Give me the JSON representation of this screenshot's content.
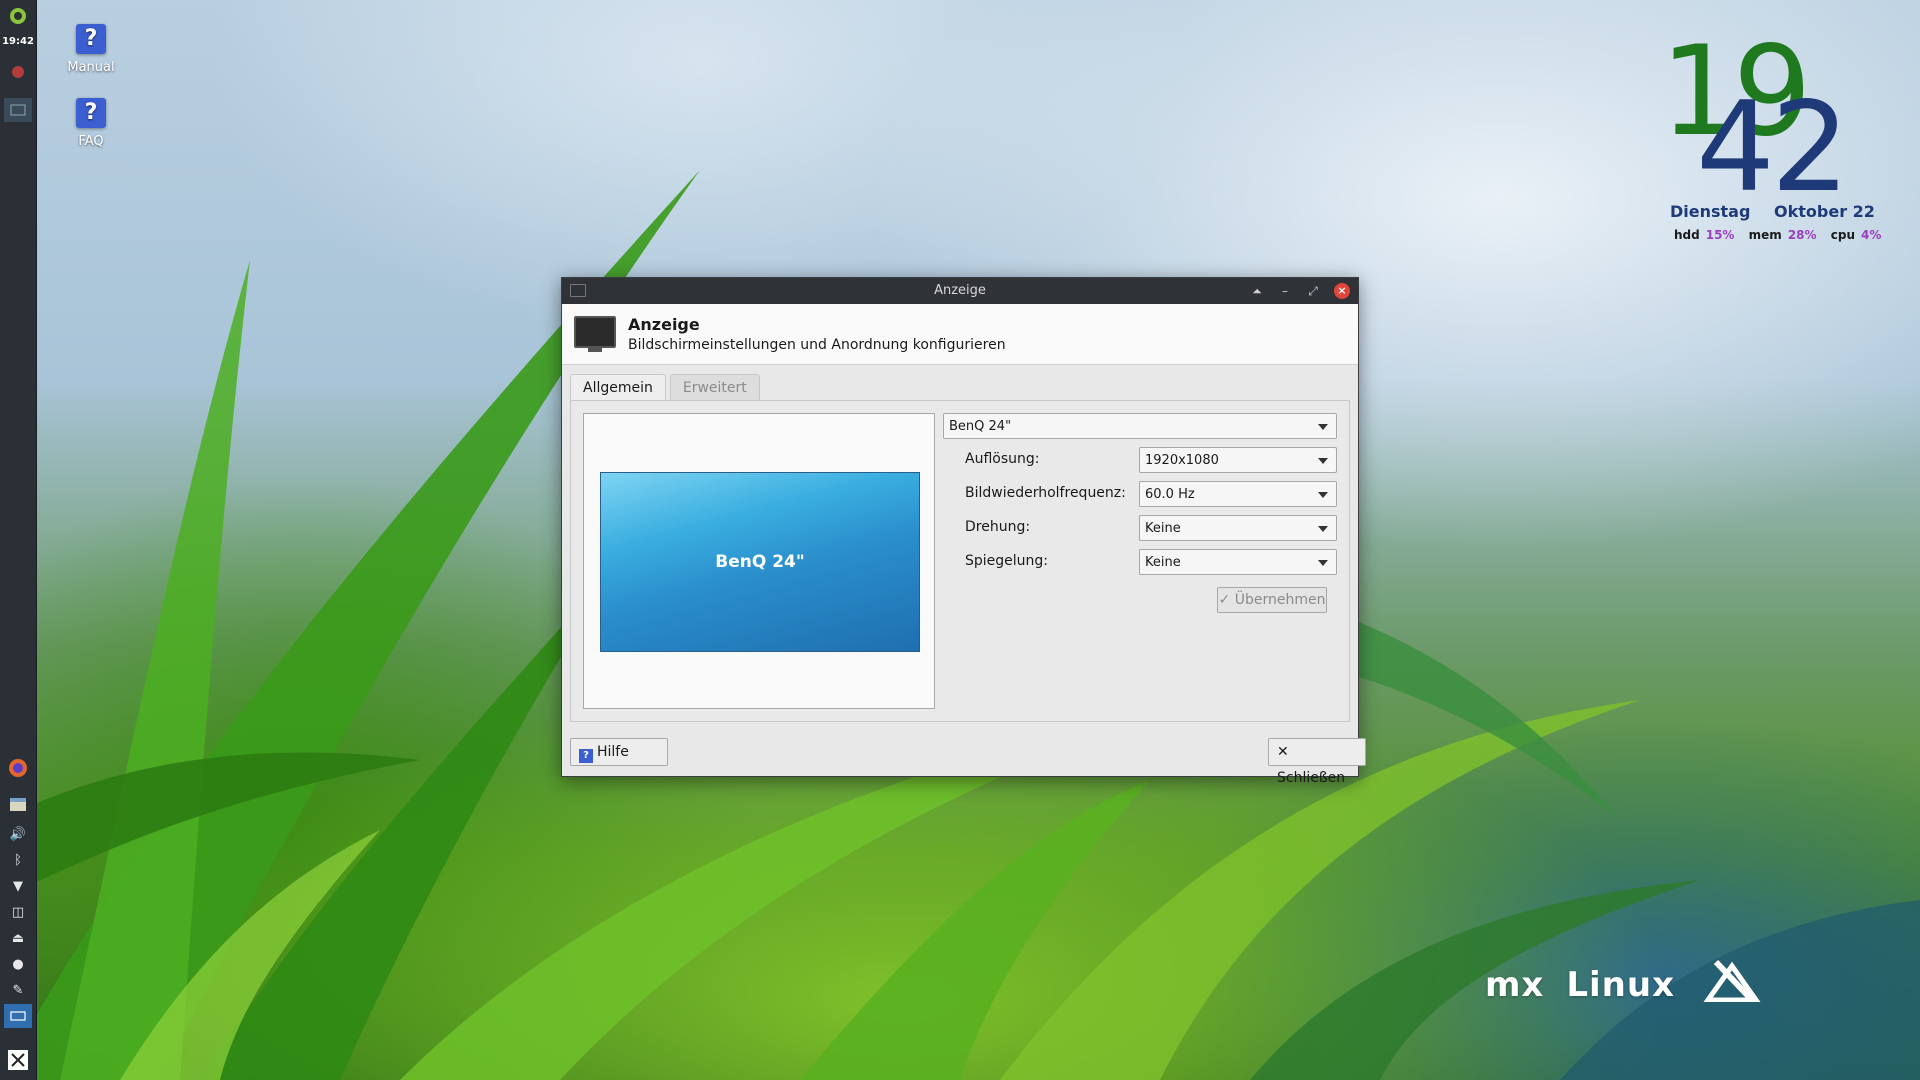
{
  "panel": {
    "clock": "19:42"
  },
  "desktop": {
    "icons": [
      {
        "label": "Manual"
      },
      {
        "label": "FAQ"
      }
    ]
  },
  "conky": {
    "hour": "19",
    "minute": "42",
    "weekday": "Dienstag",
    "month_day": "Oktober 22",
    "stats": [
      {
        "label": "hdd",
        "value": "15%"
      },
      {
        "label": "mem",
        "value": "28%"
      },
      {
        "label": "cpu",
        "value": "4%"
      }
    ],
    "colors": {
      "hour": "#1f7a1f",
      "minute": "#1f3a78",
      "stat_value": "#9b3fc0"
    }
  },
  "logo": {
    "part1": "mx",
    "part2": "Linux"
  },
  "dialog": {
    "window_title": "Anzeige",
    "header_title": "Anzeige",
    "header_subtitle": "Bildschirmeinstellungen und Anordnung konfigurieren",
    "tabs": [
      {
        "label": "Allgemein",
        "active": true
      },
      {
        "label": "Erweitert",
        "active": false
      }
    ],
    "preview_label": "BenQ 24\"",
    "display_select": "BenQ 24\"",
    "rows": [
      {
        "label": "Auflösung:",
        "value": "1920x1080"
      },
      {
        "label": "Bildwiederholfrequenz:",
        "value": "60.0 Hz"
      },
      {
        "label": "Drehung:",
        "value": "Keine"
      },
      {
        "label": "Spiegelung:",
        "value": "Keine"
      }
    ],
    "apply_label": "Übernehmen",
    "help_label": "Hilfe",
    "close_label": "Schließen"
  }
}
